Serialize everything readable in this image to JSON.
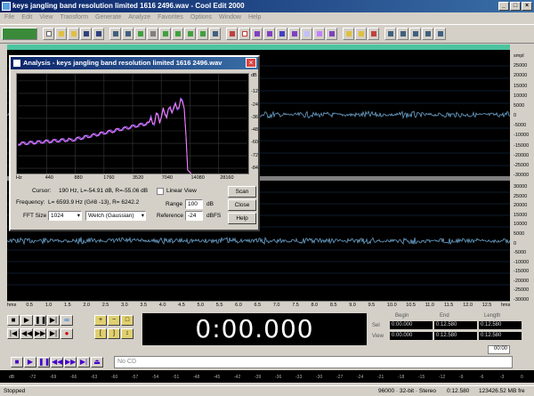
{
  "window": {
    "title": "keys jangling band resolution limited 1616 2496.wav - Cool Edit 2000"
  },
  "menu": [
    "File",
    "Edit",
    "View",
    "Transform",
    "Generate",
    "Analyze",
    "Favorites",
    "Options",
    "Window",
    "Help"
  ],
  "right_ruler": {
    "unit": "smpl",
    "ch1_ticks": [
      "25000",
      "20000",
      "15000",
      "10000",
      "5000",
      "0",
      "-5000",
      "-10000",
      "-15000",
      "-20000",
      "-25000",
      "-30000"
    ],
    "ch2_ticks": [
      "30000",
      "25000",
      "20000",
      "15000",
      "10000",
      "5000",
      "0",
      "-5000",
      "-10000",
      "-15000",
      "-20000",
      "-25000",
      "-30000"
    ]
  },
  "time_ruler": {
    "start": "hms",
    "ticks": [
      "0.5",
      "1.0",
      "1.5",
      "2.0",
      "2.5",
      "3.0",
      "3.5",
      "4.0",
      "4.5",
      "5.0",
      "5.5",
      "6.0",
      "6.5",
      "7.0",
      "7.5",
      "8.0",
      "8.5",
      "9.0",
      "9.5",
      "10.0",
      "10.5",
      "11.0",
      "11.5",
      "12.0",
      "12.5"
    ],
    "end": "hms"
  },
  "time_display": "0:00.000",
  "selection": {
    "headers": [
      "Begin",
      "End",
      "Length"
    ],
    "rows": [
      {
        "label": "Sel",
        "begin": "0:00.000",
        "end": "0:12.580",
        "length": "0:12.580"
      },
      {
        "label": "View",
        "begin": "0:00.000",
        "end": "0:12.580",
        "length": "0:12.580"
      }
    ]
  },
  "timer_small": "00:00",
  "cd": {
    "label": "No CD"
  },
  "level_scale": [
    "dB",
    "-72",
    "-69",
    "-66",
    "-63",
    "-60",
    "-57",
    "-54",
    "-51",
    "-48",
    "-45",
    "-42",
    "-39",
    "-36",
    "-33",
    "-30",
    "-27",
    "-24",
    "-21",
    "-18",
    "-15",
    "-12",
    "-9",
    "-6",
    "-3",
    "0"
  ],
  "status": {
    "state": "Stopped",
    "format": "96000 · 32-bit · Stereo",
    "length": "0:12.580",
    "free": "123426.52 MB fre"
  },
  "analysis": {
    "title": "Analysis - keys jangling band resolution limited 1616 2496.wav",
    "y_unit": "dB",
    "y_ticks": [
      "-12",
      "-24",
      "-36",
      "-48",
      "-60",
      "-72",
      "-84"
    ],
    "x_ticks": [
      "Hz",
      "440",
      "880",
      "1760",
      "3520",
      "7040",
      "14080",
      "28160"
    ],
    "cursor_label": "Cursor:",
    "cursor_value": "190 Hz, L=-54.91 dB, R=-55.06 dB",
    "frequency_label": "Frequency:",
    "frequency_value": "L= 6593.9 Hz (G#8 -13), R= 6242.2",
    "fft_label": "FFT Size",
    "fft_size": "1024",
    "window_fn": "Welch (Gaussian)",
    "linear_view": "Linear View",
    "range_label": "Range",
    "range_value": "100",
    "range_unit": "dB",
    "reference_label": "Reference",
    "reference_value": "-24",
    "reference_unit": "dBFS",
    "scan": "Scan",
    "close": "Close",
    "help": "Help",
    "spectrum_color": "#c080ff"
  }
}
